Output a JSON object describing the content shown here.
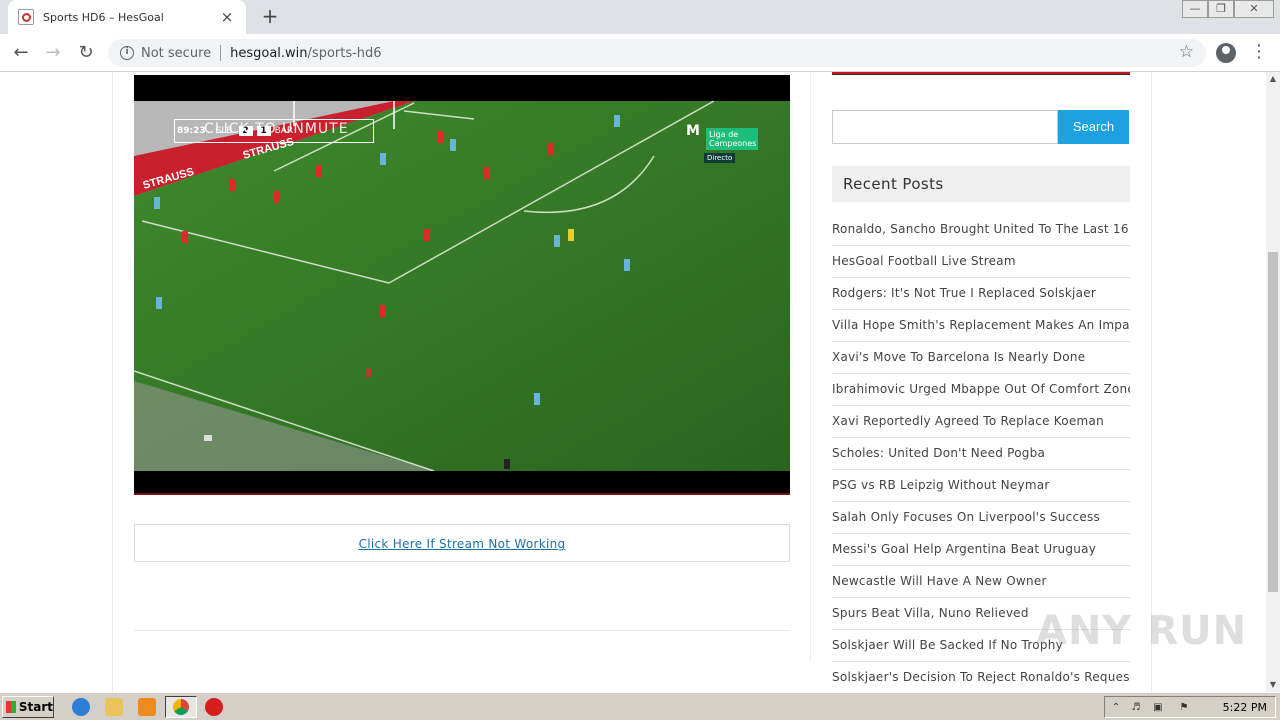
{
  "browser": {
    "tab_title": "Sports HD6 – HesGoal",
    "new_tab_symbol": "+",
    "tab_close_symbol": "×",
    "security_label": "Not secure",
    "url_host": "hesgoal.win",
    "url_path": "/sports-hd6",
    "window_controls": [
      "minimize",
      "restore",
      "close"
    ]
  },
  "player": {
    "scorebug_time": "89:23",
    "team_home": "SLB",
    "score_home": "2",
    "score_away": "1",
    "team_away": "BAR",
    "overlay_text": "CLICK TO UNMUTE",
    "broadcaster_name": "Liga de Campeones",
    "broadcaster_logo": "M",
    "live_label": "Directo"
  },
  "content": {
    "stream_link": "Click Here If Stream Not Working"
  },
  "sidebar": {
    "search_placeholder": "",
    "search_button": "Search",
    "recent_posts_title": "Recent Posts",
    "posts": [
      "Ronaldo, Sancho Brought United To The Last 16",
      "HesGoal Football Live Stream",
      "Rodgers: It's Not True I Replaced Solskjaer",
      "Villa Hope Smith's Replacement Makes An Impact",
      "Xavi's Move To Barcelona Is Nearly Done",
      "Ibrahimovic Urged Mbappe Out Of Comfort Zone",
      "Xavi Reportedly Agreed To Replace Koeman",
      "Scholes: United Don't Need Pogba",
      "PSG vs RB Leipzig Without Neymar",
      "Salah Only Focuses On Liverpool's Success",
      "Messi's Goal Help Argentina Beat Uruguay",
      "Newcastle Will Have A New Owner",
      "Spurs Beat Villa, Nuno Relieved",
      "Solskjaer Will Be Sacked If No Trophy",
      "Solskjaer's Decision To Reject Ronaldo's Request"
    ]
  },
  "watermark": "ANY RUN",
  "taskbar": {
    "start_label": "Start",
    "clock": "5:22 PM"
  }
}
